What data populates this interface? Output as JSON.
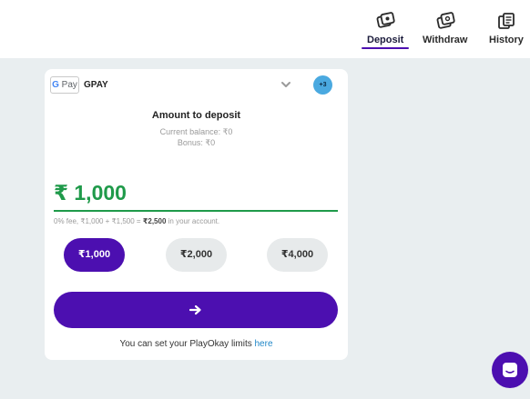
{
  "tabs": [
    {
      "label": "Deposit",
      "icon": "deposit-icon",
      "active": true
    },
    {
      "label": "Withdraw",
      "icon": "withdraw-icon",
      "active": false
    },
    {
      "label": "History",
      "icon": "history-icon",
      "active": false
    }
  ],
  "payment_method": {
    "logo_g": "G",
    "logo_text": " Pay",
    "name": "GPAY",
    "badge": "+3"
  },
  "deposit": {
    "title": "Amount to deposit",
    "current_balance": "Current balance: ₹0",
    "bonus": "Bonus: ₹0",
    "amount": "₹ 1,000",
    "fee_prefix": "0% fee, ₹1,000 + ₹1,500 = ",
    "fee_total": "₹2,500",
    "fee_suffix": " in your account."
  },
  "quick_amounts": [
    {
      "label": "₹1,000",
      "selected": true
    },
    {
      "label": "₹2,000",
      "selected": false
    },
    {
      "label": "₹4,000",
      "selected": false
    }
  ],
  "limits": {
    "text": "You can set your PlayOkay limits ",
    "link": "here"
  },
  "colors": {
    "accent": "#4c0fb0",
    "amount_green": "#1f9a4a",
    "link": "#1f86c7",
    "background": "#e9eef0"
  }
}
